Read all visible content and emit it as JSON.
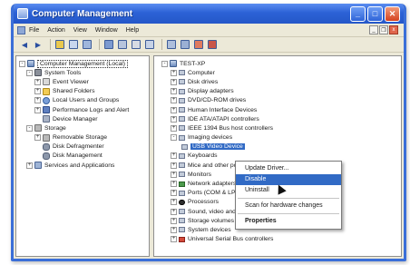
{
  "window": {
    "title": "Computer Management"
  },
  "menubar": {
    "items": [
      "File",
      "Action",
      "View",
      "Window",
      "Help"
    ]
  },
  "mdi_controls": {
    "minimize": "_",
    "restore": "❐",
    "close": "x"
  },
  "toolbar": {
    "icons": [
      "back-arrow-icon",
      "forward-arrow-icon",
      "up-folder-icon",
      "show-hide-tree-icon",
      "properties-icon",
      "help-icon",
      "export-icon",
      "print-icon",
      "refresh-icon",
      "scan-hardware-icon",
      "update-driver-icon",
      "uninstall-icon",
      "disable-icon"
    ]
  },
  "left_tree": [
    {
      "label": "Computer Management (Local)",
      "level": 0,
      "expander": "-",
      "icon": "computer-icon"
    },
    {
      "label": "System Tools",
      "level": 1,
      "expander": "-",
      "icon": "tools-icon"
    },
    {
      "label": "Event Viewer",
      "level": 2,
      "expander": "+",
      "icon": "event-viewer-icon"
    },
    {
      "label": "Shared Folders",
      "level": 2,
      "expander": "+",
      "icon": "folder-icon"
    },
    {
      "label": "Local Users and Groups",
      "level": 2,
      "expander": "+",
      "icon": "users-icon"
    },
    {
      "label": "Performance Logs and Alert",
      "level": 2,
      "expander": "+",
      "icon": "performance-icon"
    },
    {
      "label": "Device Manager",
      "level": 2,
      "expander": "",
      "icon": "device-manager-icon"
    },
    {
      "label": "Storage",
      "level": 1,
      "expander": "-",
      "icon": "storage-icon"
    },
    {
      "label": "Removable Storage",
      "level": 2,
      "expander": "+",
      "icon": "removable-storage-icon"
    },
    {
      "label": "Disk Defragmenter",
      "level": 2,
      "expander": "",
      "icon": "defrag-icon"
    },
    {
      "label": "Disk Management",
      "level": 2,
      "expander": "",
      "icon": "disk-icon"
    },
    {
      "label": "Services and Applications",
      "level": 1,
      "expander": "+",
      "icon": "services-icon"
    }
  ],
  "right_tree": {
    "root": "TEST-XP",
    "items": [
      {
        "label": "Computer",
        "expander": "+",
        "icon": "computer-icon"
      },
      {
        "label": "Disk drives",
        "expander": "+",
        "icon": "disk-icon"
      },
      {
        "label": "Display adapters",
        "expander": "+",
        "icon": "display-icon"
      },
      {
        "label": "DVD/CD-ROM drives",
        "expander": "+",
        "icon": "dvd-icon"
      },
      {
        "label": "Human Interface Devices",
        "expander": "+",
        "icon": "hid-icon"
      },
      {
        "label": "IDE ATA/ATAPI controllers",
        "expander": "+",
        "icon": "ide-icon"
      },
      {
        "label": "IEEE 1394 Bus host controllers",
        "expander": "+",
        "icon": "ieee1394-icon"
      },
      {
        "label": "Imaging devices",
        "expander": "-",
        "icon": "imaging-icon"
      },
      {
        "label": "USB Video Device",
        "expander": "",
        "icon": "camera-icon",
        "child": true,
        "selected": true
      },
      {
        "label": "Keyboards",
        "expander": "+",
        "icon": "keyboard-icon"
      },
      {
        "label": "Mice and other pc",
        "expander": "+",
        "icon": "mouse-icon"
      },
      {
        "label": "Monitors",
        "expander": "+",
        "icon": "monitor-icon"
      },
      {
        "label": "Network adapters",
        "expander": "+",
        "icon": "network-icon"
      },
      {
        "label": "Ports (COM & LPT",
        "expander": "+",
        "icon": "port-icon"
      },
      {
        "label": "Processors",
        "expander": "+",
        "icon": "processor-icon"
      },
      {
        "label": "Sound, video and game controllers",
        "expander": "+",
        "icon": "sound-icon"
      },
      {
        "label": "Storage volumes",
        "expander": "+",
        "icon": "storage-volume-icon"
      },
      {
        "label": "System devices",
        "expander": "+",
        "icon": "system-device-icon"
      },
      {
        "label": "Universal Serial Bus controllers",
        "expander": "+",
        "icon": "usb-icon"
      }
    ]
  },
  "context_menu": {
    "update_driver": "Update Driver...",
    "disable": "Disable",
    "uninstall": "Uninstall",
    "scan": "Scan for hardware changes",
    "properties": "Properties"
  },
  "colors": {
    "titlebar": "#2c62d6",
    "selection": "#316ac5",
    "window_bg": "#ece9d8"
  }
}
